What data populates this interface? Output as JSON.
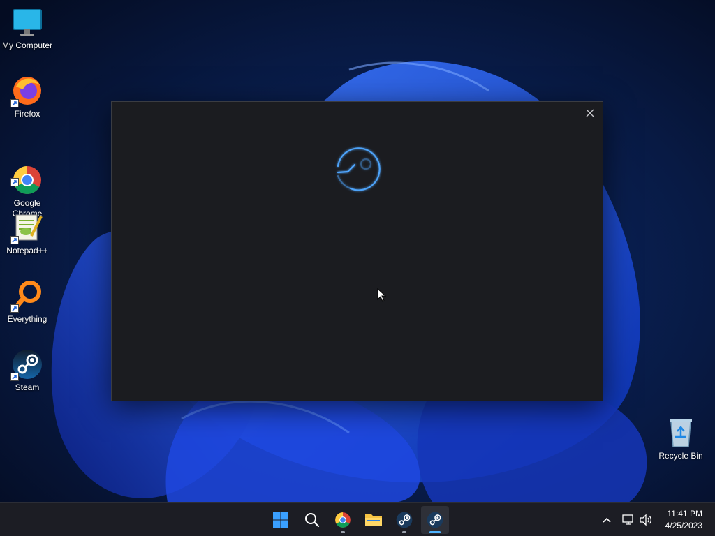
{
  "desktop": {
    "icons": [
      {
        "label": "My Computer",
        "icon": "monitor-icon"
      },
      {
        "label": "Firefox",
        "icon": "firefox-icon"
      },
      {
        "label": "Google\nChrome",
        "icon": "chrome-icon"
      },
      {
        "label": "Notepad++",
        "icon": "notepadpp-icon"
      },
      {
        "label": "Everything",
        "icon": "everything-icon"
      },
      {
        "label": "Steam",
        "icon": "steam-icon"
      },
      {
        "label": "Recycle Bin",
        "icon": "recycle-bin-icon"
      }
    ]
  },
  "window": {
    "app": "Steam",
    "state": "loading",
    "close_icon": "close-icon"
  },
  "taskbar": {
    "pinned": [
      {
        "name": "start",
        "icon": "windows-logo-icon",
        "running": false,
        "active": false
      },
      {
        "name": "search",
        "icon": "search-icon",
        "running": false,
        "active": false
      },
      {
        "name": "chrome",
        "icon": "chrome-icon",
        "running": true,
        "active": false
      },
      {
        "name": "file-explorer",
        "icon": "folder-icon",
        "running": false,
        "active": false
      },
      {
        "name": "steam",
        "icon": "steam-icon",
        "running": true,
        "active": false
      },
      {
        "name": "steam-window",
        "icon": "steam-icon",
        "running": true,
        "active": true
      }
    ],
    "tray": {
      "icons": [
        "chevron-up-icon",
        "network-icon",
        "volume-icon"
      ],
      "time": "11:41 PM",
      "date": "4/25/2023"
    }
  },
  "colors": {
    "accent": "#4fb4ff",
    "window_bg": "#1b1c20",
    "taskbar_bg": "#1c1d24"
  }
}
